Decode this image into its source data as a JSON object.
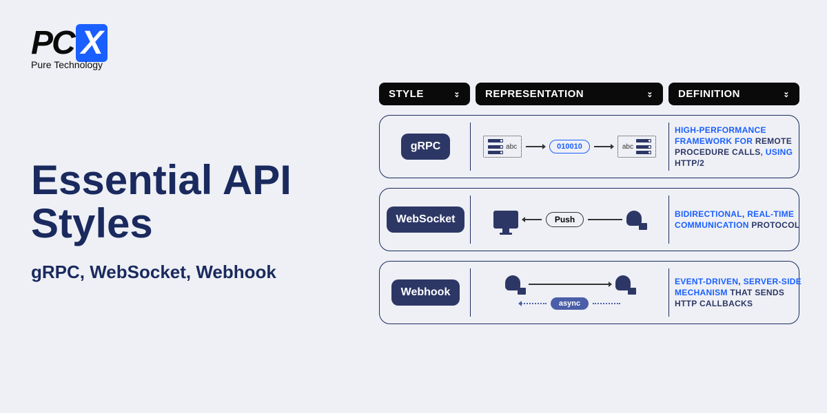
{
  "logo": {
    "pc": "PC",
    "x": "X",
    "tagline": "Pure Technology"
  },
  "title": {
    "line1": "Essential API",
    "line2": "Styles",
    "subtitle": "gRPC, WebSocket, Webhook"
  },
  "headers": {
    "style": "STYLE",
    "representation": "REPRESENTATION",
    "definition": "DEFINITION"
  },
  "rows": [
    {
      "name": "gRPC",
      "repr": {
        "binary": "010010",
        "abc": "abc"
      },
      "def_parts": [
        {
          "t": "HIGH-PERFORMANCE FRAMEWORK FOR ",
          "c": "p"
        },
        {
          "t": "REMOTE PROCEDURE CALLS",
          "c": "a"
        },
        {
          "t": ", USING ",
          "c": "p"
        },
        {
          "t": "HTTP/2",
          "c": "a"
        }
      ]
    },
    {
      "name": "WebSocket",
      "repr": {
        "push": "Push"
      },
      "def_parts": [
        {
          "t": "BIDIRECTIONAL",
          "c": "p"
        },
        {
          "t": ", ",
          "c": "a"
        },
        {
          "t": "REAL-TIME COMMUNICATION ",
          "c": "p"
        },
        {
          "t": "PROTOCOL",
          "c": "a"
        }
      ]
    },
    {
      "name": "Webhook",
      "repr": {
        "async": "async"
      },
      "def_parts": [
        {
          "t": "EVENT-DRIVEN",
          "c": "p"
        },
        {
          "t": ", ",
          "c": "a"
        },
        {
          "t": "SERVER-SIDE MECHANISM ",
          "c": "p"
        },
        {
          "t": "THAT SENDS HTTP CALLBACKS",
          "c": "a"
        }
      ]
    }
  ]
}
